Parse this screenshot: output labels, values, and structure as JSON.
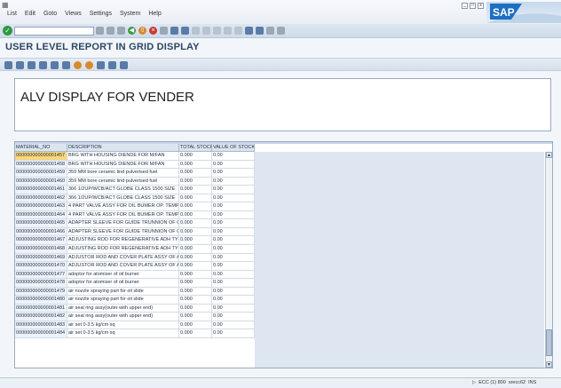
{
  "menubar": {
    "items": [
      "List",
      "Edit",
      "Goto",
      "Views",
      "Settings",
      "System",
      "Help"
    ],
    "logo_text": "SAP"
  },
  "page": {
    "title": "USER LEVEL REPORT IN GRID DISPLAY"
  },
  "report": {
    "heading": "ALV DISPLAY FOR VENDER"
  },
  "grid": {
    "columns": [
      "MATERIAL_NO",
      "DESCRIPTION",
      "TOTAL STOCK",
      "VALUE OF STOCK"
    ],
    "rows": [
      [
        "000000000000001457",
        "BRG WITH HOUSING DIENDE FOR M/FAN",
        "0.000",
        "0.00"
      ],
      [
        "000000000000001458",
        "BRG WITH HOUSING DIENDE FOR M/FAN",
        "0.000",
        "0.00"
      ],
      [
        "000000000000001459",
        "359 MM bore ceramic lind pulverised fuel",
        "0.000",
        "0.00"
      ],
      [
        "000000000000001460",
        "359 MM bore ceramic lind pulverised fuel",
        "0.000",
        "0.00"
      ],
      [
        "000000000000001461",
        "366 1/2UP/WCB/ACT GLOBE CLASS 1500 SIZE",
        "0.000",
        "0.00"
      ],
      [
        "000000000000001462",
        "366 1/2UP/WCB/ACT GLOBE CLASS 1500 SIZE",
        "0.000",
        "0.00"
      ],
      [
        "000000000000001463",
        "4 PART VALVE ASSY FOR OIL BUMER OP. TEMP",
        "0.000",
        "0.00"
      ],
      [
        "000000000000001464",
        "4 PART VALVE ASSY FOR OIL BUMER OP. TEMP",
        "0.000",
        "0.00"
      ],
      [
        "000000000000001465",
        "ADAPTER SLEEVE FOR GUIDE TRUNNION OF GUI",
        "0.000",
        "0.00"
      ],
      [
        "000000000000001466",
        "ADAPTER SLEEVE FOR GUIDE TRUNNION OF GUI",
        "0.000",
        "0.00"
      ],
      [
        "000000000000001467",
        "ADJUSTING ROD FOR REGENERATIVE ADH TYPE",
        "0.000",
        "0.00"
      ],
      [
        "000000000000001468",
        "ADJUSTING ROD FOR REGENERATIVE ADH TYPE",
        "0.000",
        "0.00"
      ],
      [
        "000000000000001469",
        "ADJUSTOR ROD AND COVER PLATE ASSY OF AXI",
        "0.000",
        "0.00"
      ],
      [
        "000000000000001470",
        "ADJUSTOR ROD AND COVER PLATE ASSY OF AXI",
        "0.000",
        "0.00"
      ],
      [
        "000000000000001477",
        "adoptor for atomiser of oil burner",
        "0.000",
        "0.00"
      ],
      [
        "000000000000001478",
        "adoptor for atomiser of oil burner",
        "0.000",
        "0.00"
      ],
      [
        "000000000000001479",
        "air nozzle spraying part for oil slide",
        "0.000",
        "0.00"
      ],
      [
        "000000000000001480",
        "air nozzle spraying part for oil slide",
        "0.000",
        "0.00"
      ],
      [
        "000000000000001481",
        "air seal ring assy(outer with upper end)",
        "0.000",
        "0.00"
      ],
      [
        "000000000000001482",
        "air seal ring assy(outer with upper end)",
        "0.000",
        "0.00"
      ],
      [
        "000000000000001483",
        "air set 0-3.5 kg/cm sq",
        "0.000",
        "0.00"
      ],
      [
        "000000000000001484",
        "air set 0-3.5 kg/cm sq",
        "0.000",
        "0.00"
      ]
    ]
  },
  "statusbar": {
    "system": "ECC (1) 800",
    "server": "srecc62",
    "mode": "INS"
  }
}
